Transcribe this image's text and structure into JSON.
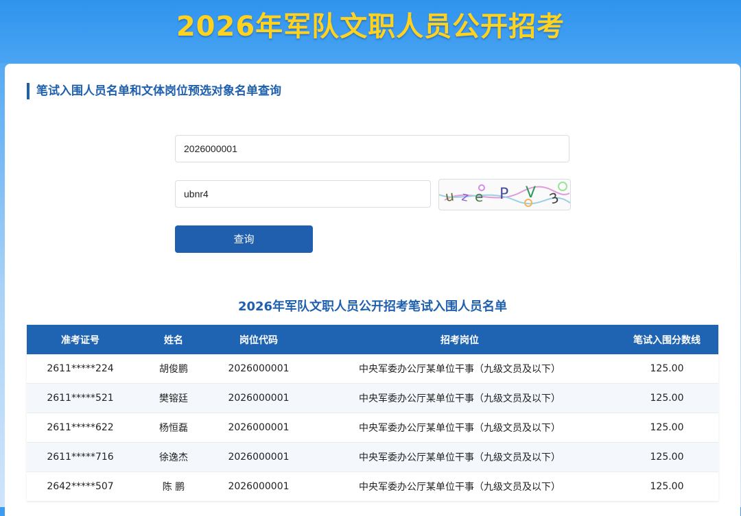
{
  "header": {
    "site_title": "2026年军队文职人员公开招考"
  },
  "section": {
    "title": "笔试入围人员名单和文体岗位预选对象名单查询"
  },
  "form": {
    "exam_id_value": "2026000001",
    "captcha_value": "ubnr4",
    "captcha_text": "uzePV3",
    "query_label": "查询"
  },
  "list": {
    "title": "2026年军队文职人员公开招考笔试入围人员名单",
    "headers": [
      "准考证号",
      "姓名",
      "岗位代码",
      "招考岗位",
      "笔试入围分数线"
    ],
    "rows": [
      [
        "2611*****224",
        "胡俊鹏",
        "2026000001",
        "中央军委办公厅某单位干事（九级文员及以下）",
        "125.00"
      ],
      [
        "2611*****521",
        "樊镕廷",
        "2026000001",
        "中央军委办公厅某单位干事（九级文员及以下）",
        "125.00"
      ],
      [
        "2611*****622",
        "杨恒磊",
        "2026000001",
        "中央军委办公厅某单位干事（九级文员及以下）",
        "125.00"
      ],
      [
        "2611*****716",
        "徐逸杰",
        "2026000001",
        "中央军委办公厅某单位干事（九级文员及以下）",
        "125.00"
      ],
      [
        "2642*****507",
        "陈 鹏",
        "2026000001",
        "中央军委办公厅某单位干事（九级文员及以下）",
        "125.00"
      ]
    ]
  }
}
